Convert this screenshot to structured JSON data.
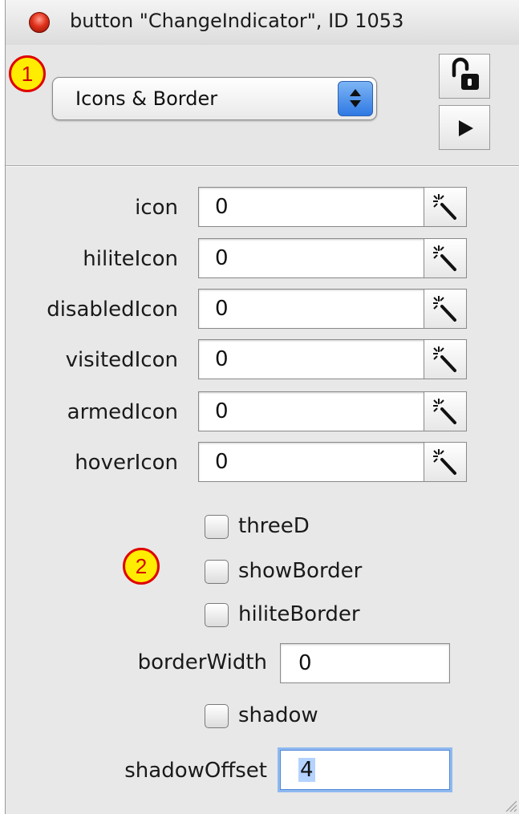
{
  "window": {
    "title": "button \"ChangeIndicator\", ID 1053"
  },
  "header": {
    "selector": {
      "value": "Icons & Border"
    },
    "lock_icon": "padlock-open-icon",
    "play_icon": "play-triangle-icon"
  },
  "callouts": [
    "1",
    "2"
  ],
  "icons": [
    {
      "label": "icon",
      "value": "0"
    },
    {
      "label": "hiliteIcon",
      "value": "0"
    },
    {
      "label": "disabledIcon",
      "value": "0"
    },
    {
      "label": "visitedIcon",
      "value": "0"
    },
    {
      "label": "armedIcon",
      "value": "0"
    },
    {
      "label": "hoverIcon",
      "value": "0"
    }
  ],
  "checkboxes": [
    {
      "label": "threeD",
      "checked": false
    },
    {
      "label": "showBorder",
      "checked": false
    },
    {
      "label": "hiliteBorder",
      "checked": false
    },
    {
      "label": "shadow",
      "checked": false
    }
  ],
  "borderWidth": {
    "label": "borderWidth",
    "value": "0"
  },
  "shadowOffset": {
    "label": "shadowOffset",
    "value": "4"
  },
  "colors": {
    "callout_fill": "#ffec00",
    "callout_ring": "#e00000",
    "accent": "#2f79e3",
    "close": "#e0321c"
  }
}
